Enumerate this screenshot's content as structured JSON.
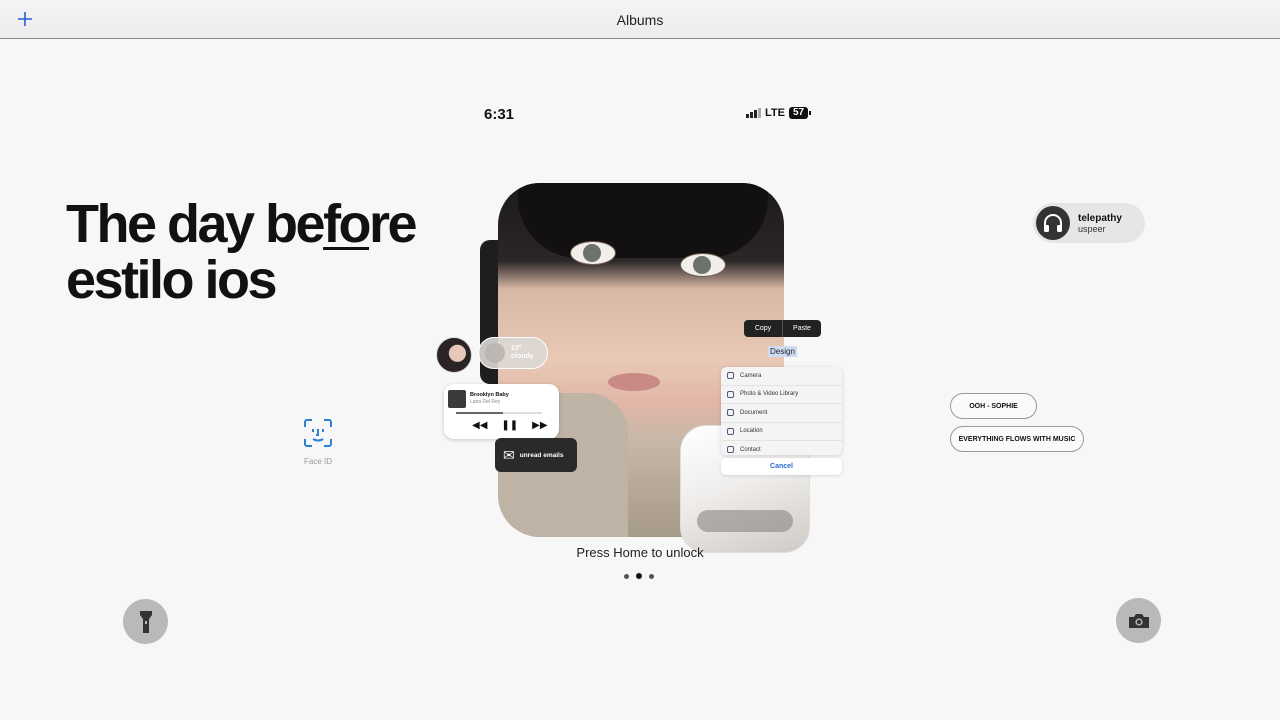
{
  "topbar": {
    "title": "Albums"
  },
  "status": {
    "time": "6:31",
    "network": "LTE",
    "battery": "57"
  },
  "headline": {
    "line1_a": "The day be",
    "line1_b": "fo",
    "line1_c": "re",
    "line2": "estilo ios"
  },
  "weather": {
    "temp": "13°",
    "cond": "cloudy"
  },
  "music_widget": {
    "track": "Brooklyn Baby",
    "artist": "Lana Del Rey",
    "progress": 0.55
  },
  "email_widget": {
    "title": "unread emails"
  },
  "edit_menu": {
    "copy": "Copy",
    "paste": "Paste",
    "selected": "Design"
  },
  "attach_sheet": {
    "items": [
      "Camera",
      "Photo & Video Library",
      "Document",
      "Location",
      "Contact"
    ],
    "cancel": "Cancel"
  },
  "lock": {
    "unlock_text": "Press Home to unlock"
  },
  "faceid": {
    "label": "Face ID"
  },
  "now_playing": {
    "title": "telepathy",
    "artist": "uspeer"
  },
  "chips": [
    "OOH - SOPHIE",
    "EVERYTHING FLOWS WITH MUSIC"
  ],
  "icons": {
    "add": "plus-icon",
    "flashlight": "flashlight-icon",
    "camera": "camera-icon",
    "faceid": "faceid-icon",
    "headphones": "headphones-icon"
  }
}
